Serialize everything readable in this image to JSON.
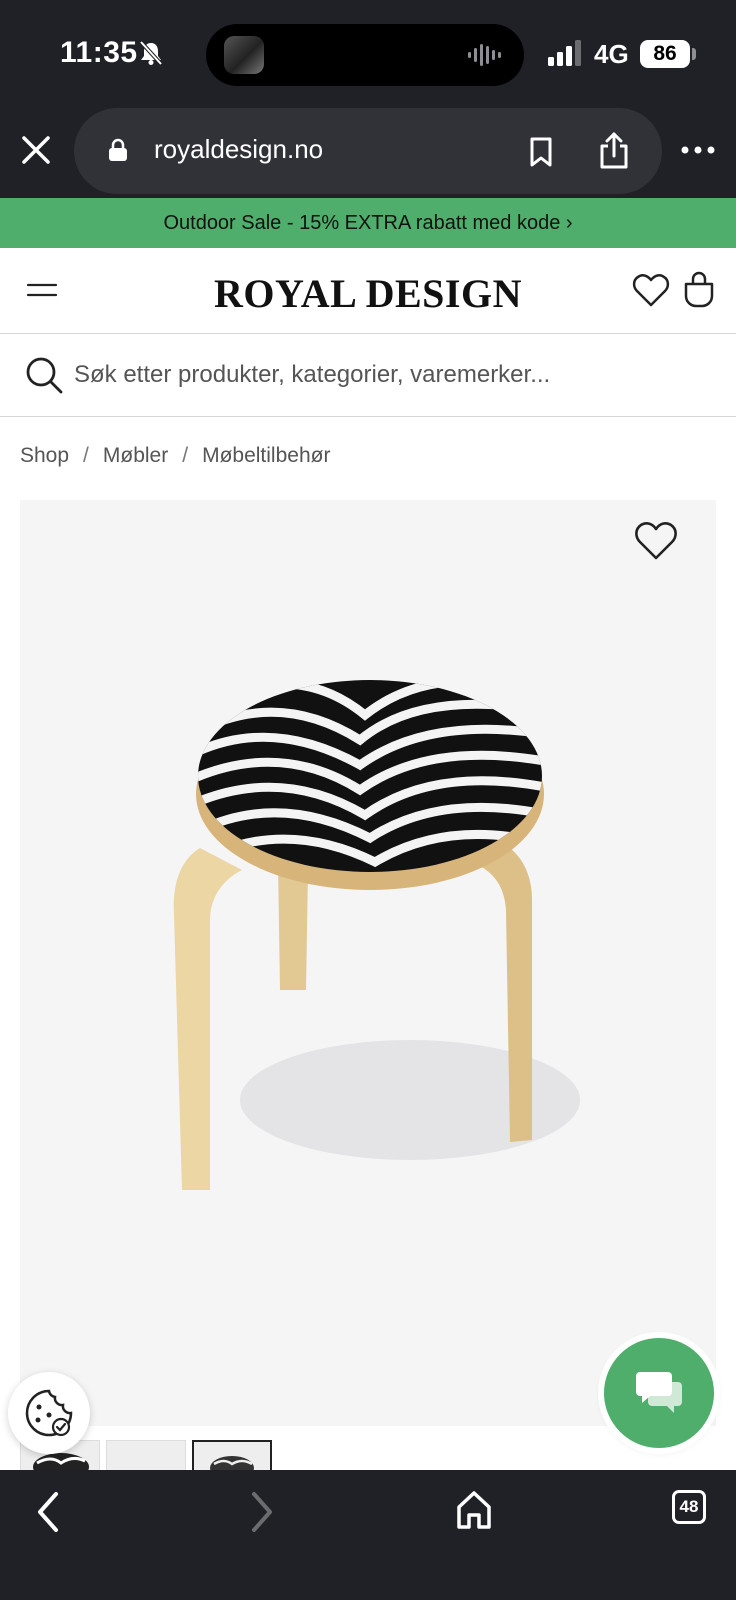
{
  "status_bar": {
    "time": "11:35",
    "network": "4G",
    "battery": "86"
  },
  "browser": {
    "url": "royaldesign.no",
    "tab_count": "48"
  },
  "promo_banner": {
    "text": "Outdoor Sale - 15% EXTRA rabatt med kode ›"
  },
  "header": {
    "logo": "ROYAL DESIGN"
  },
  "search": {
    "placeholder": "Søk etter produkter, kategorier, varemerker..."
  },
  "breadcrumb": {
    "items": [
      "Shop",
      "Møbler",
      "Møbeltilbehør"
    ],
    "separator": "/"
  },
  "colors": {
    "browser_chrome": "#202126",
    "promo_green": "#4fae6c",
    "chat_green": "#4fae6c",
    "image_bg": "#f5f5f6"
  },
  "icons": {
    "status": [
      "silent-bell-icon",
      "signal-icon",
      "battery-icon"
    ],
    "browser": [
      "close-icon",
      "lock-icon",
      "bookmark-icon",
      "share-icon",
      "more-icon",
      "back-icon",
      "forward-icon",
      "home-icon",
      "tabs-icon"
    ],
    "site": [
      "menu-icon",
      "heart-icon",
      "bag-icon",
      "search-icon",
      "cookie-icon",
      "chat-icon"
    ]
  }
}
